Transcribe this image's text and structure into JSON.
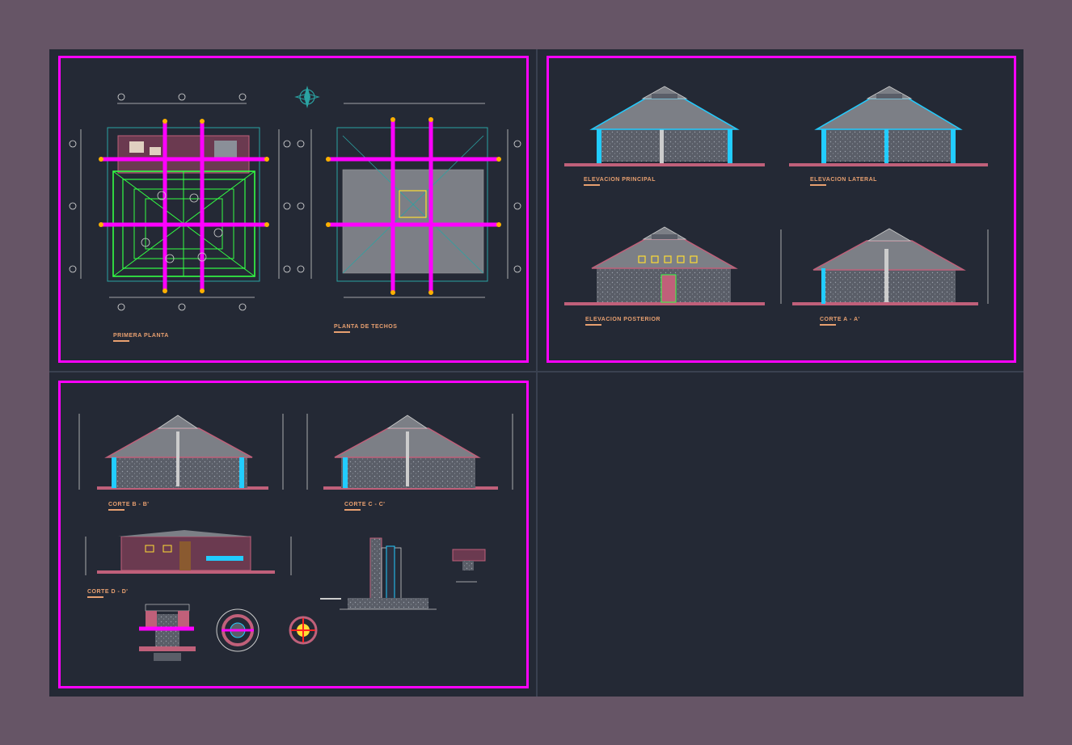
{
  "colors": {
    "background": "#665566",
    "canvas": "#242935",
    "frame": "#ff00ff",
    "label": "#e8a070",
    "wall_cyan": "#22ccff",
    "roof_gray": "#7c7f86",
    "structure_green": "#33ff44",
    "brick": "#c0607a"
  },
  "sheet1": {
    "label_primera_planta": "PRIMERA PLANTA",
    "label_planta_techos": "PLANTA DE TECHOS"
  },
  "sheet2": {
    "label_elev_principal": "ELEVACION PRINCIPAL",
    "label_elev_lateral": "ELEVACION LATERAL",
    "label_elev_posterior": "ELEVACION POSTERIOR",
    "label_corte_aa": "CORTE A - A'"
  },
  "sheet3": {
    "label_corte_bb": "CORTE B - B'",
    "label_corte_cc": "CORTE C - C'",
    "label_corte_dd": "CORTE D - D'"
  }
}
